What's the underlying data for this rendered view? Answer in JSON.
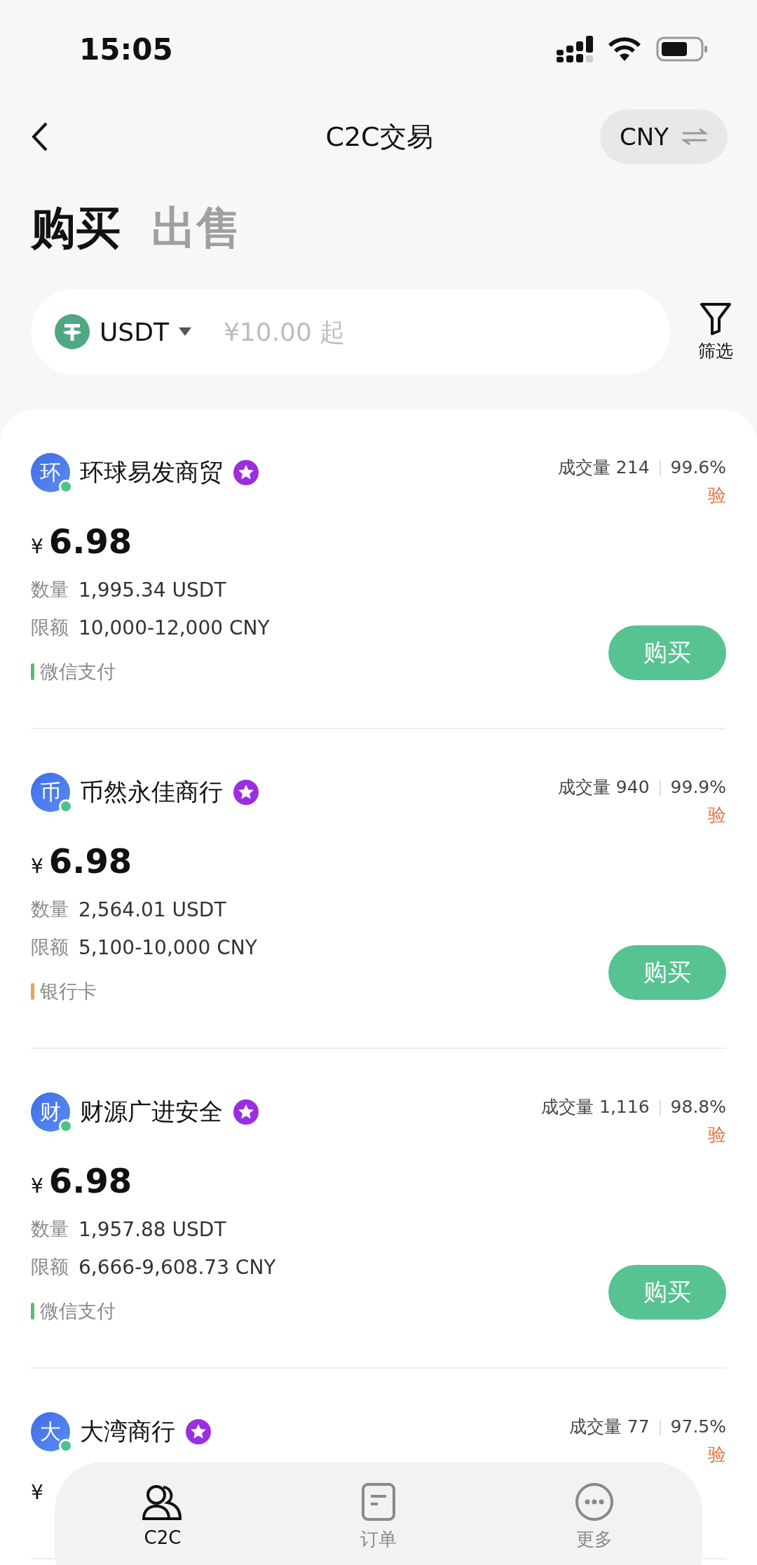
{
  "status_bar": {
    "time": "15:05"
  },
  "header": {
    "title": "C2C交易",
    "currency": "CNY"
  },
  "tabs": [
    {
      "label": "购买",
      "selected": true
    },
    {
      "label": "出售",
      "selected": false
    }
  ],
  "search": {
    "coin": "USDT",
    "placeholder": "¥10.00 起",
    "filter_label": "筛选"
  },
  "offers": [
    {
      "avatar": "环",
      "name": "环球易发商贸",
      "online": true,
      "trades_label": "成交量",
      "trades": "214",
      "rate": "99.6%",
      "verified": "验",
      "currency": "¥",
      "price": "6.98",
      "qty_label": "数量",
      "qty": "1,995.34 USDT",
      "limit_label": "限额",
      "limit": "10,000-12,000 CNY",
      "payment": "微信支付",
      "color": "#5bb974",
      "action": "购买"
    },
    {
      "avatar": "币",
      "name": "币然永佳商行",
      "online": true,
      "trades_label": "成交量",
      "trades": "940",
      "rate": "99.9%",
      "verified": "验",
      "currency": "¥",
      "price": "6.98",
      "qty_label": "数量",
      "qty": "2,564.01 USDT",
      "limit_label": "限额",
      "limit": "5,100-10,000 CNY",
      "payment": "银行卡",
      "color": "#f0a05a",
      "action": "购买"
    },
    {
      "avatar": "财",
      "name": "财源广进安全",
      "online": true,
      "trades_label": "成交量",
      "trades": "1,116",
      "rate": "98.8%",
      "verified": "验",
      "currency": "¥",
      "price": "6.98",
      "qty_label": "数量",
      "qty": "1,957.88 USDT",
      "limit_label": "限额",
      "limit": "6,666-9,608.73 CNY",
      "payment": "微信支付",
      "color": "#5bb974",
      "action": "购买"
    },
    {
      "avatar": "大",
      "name": "大湾商行",
      "online": true,
      "trades_label": "成交量",
      "trades": "77",
      "rate": "97.5%",
      "verified": "验",
      "currency": "¥"
    }
  ],
  "nav": [
    {
      "kind": "c2c",
      "label": "C2C",
      "selected": true
    },
    {
      "kind": "orders",
      "label": "订单",
      "selected": false
    },
    {
      "kind": "more",
      "label": "更多",
      "selected": false
    }
  ]
}
